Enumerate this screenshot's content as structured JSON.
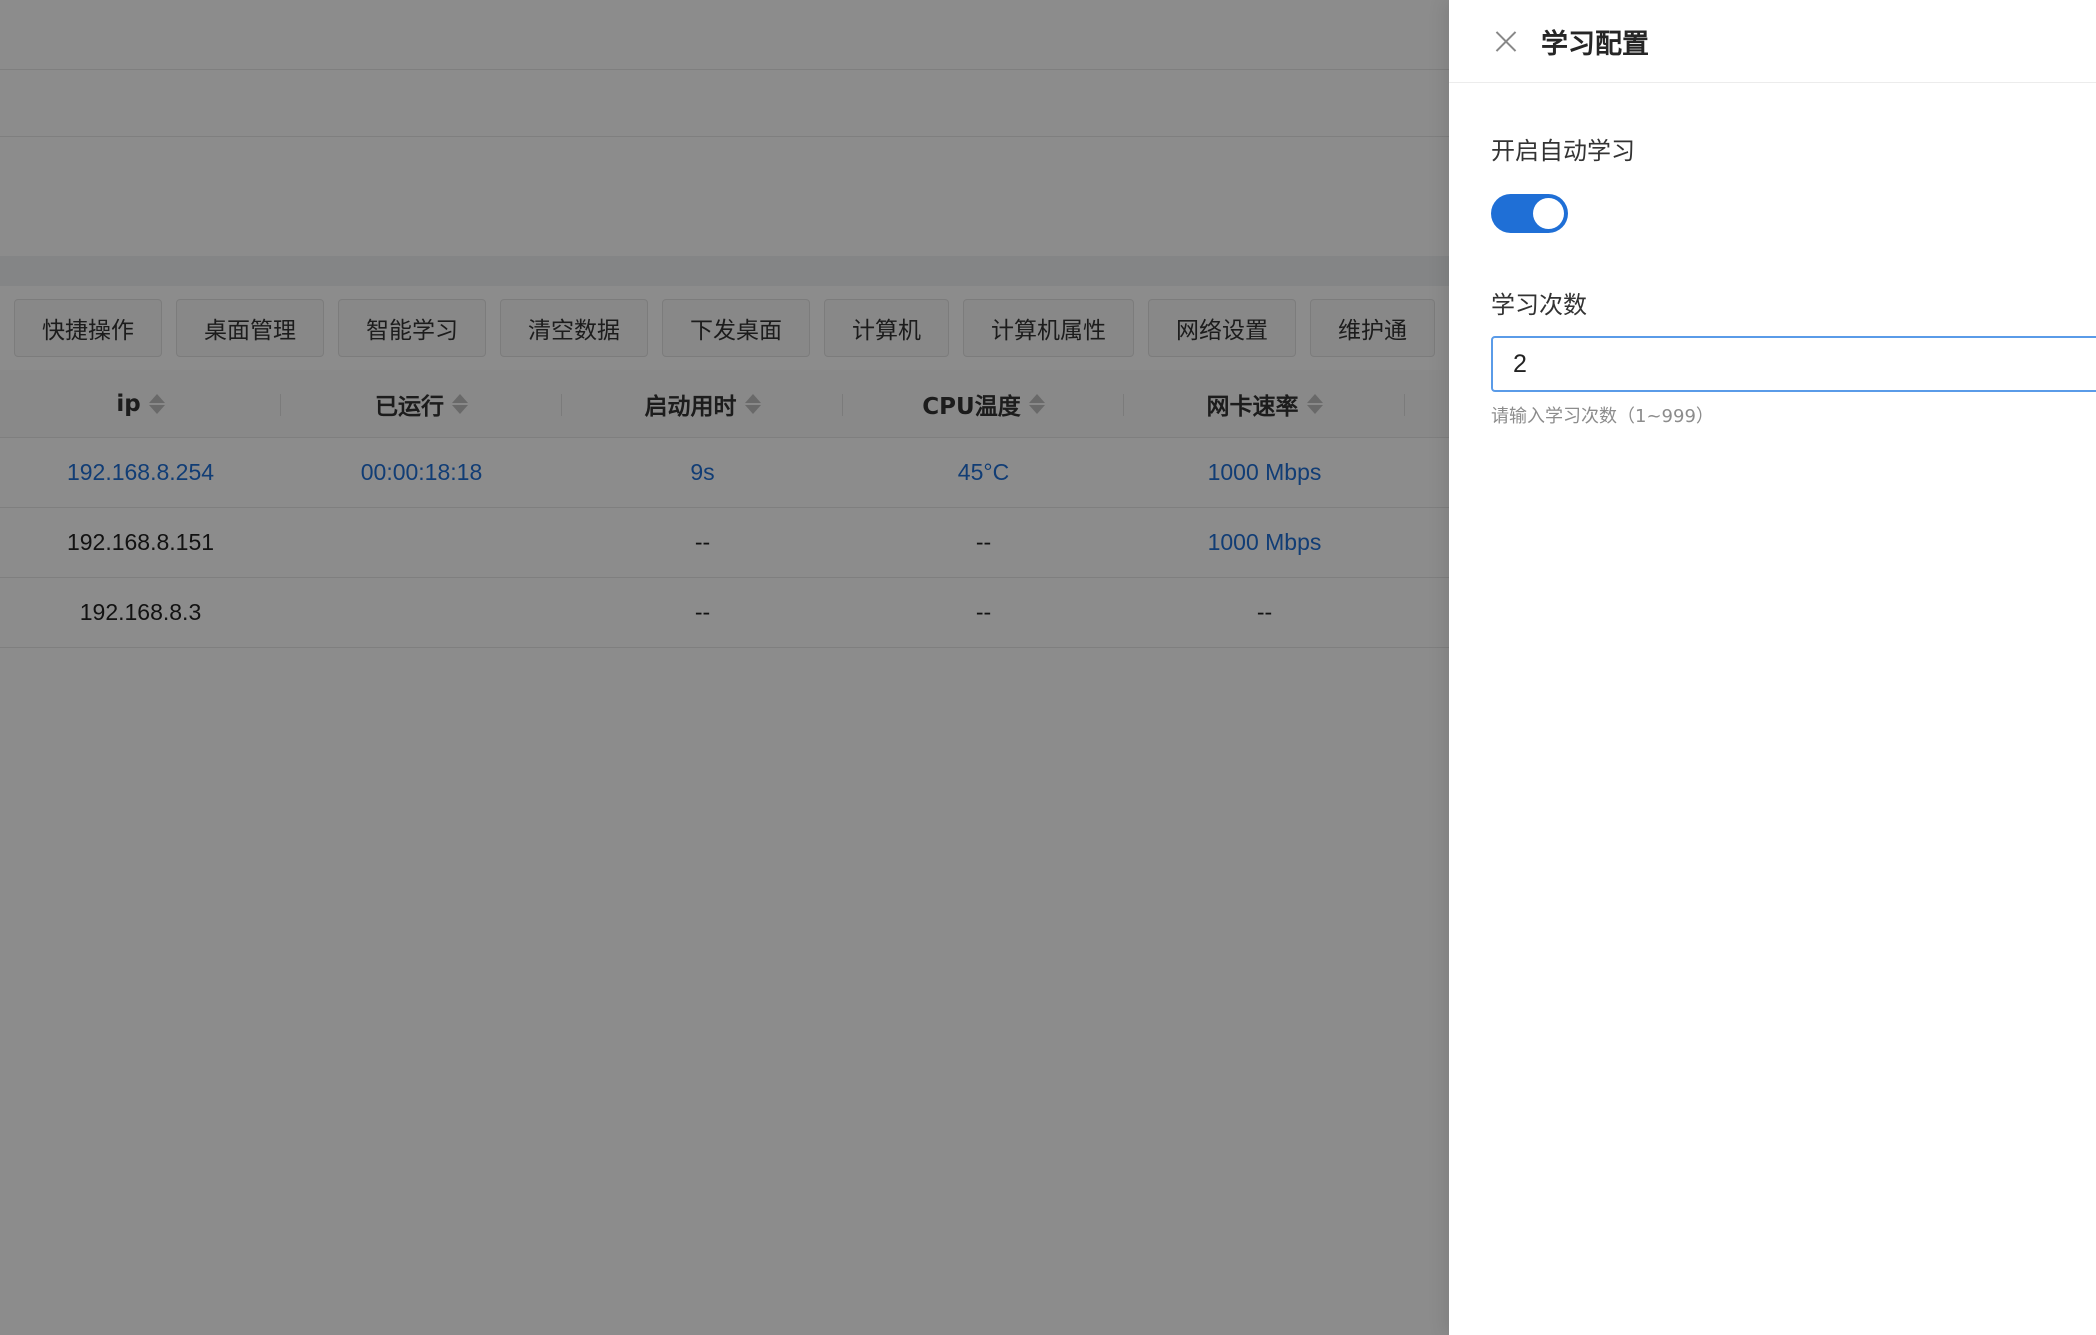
{
  "toolbar": {
    "buttons": [
      "快捷操作",
      "桌面管理",
      "智能学习",
      "清空数据",
      "下发桌面",
      "计算机",
      "计算机属性",
      "网络设置",
      "维护通"
    ]
  },
  "table": {
    "columns": [
      "ip",
      "已运行",
      "启动用时",
      "CPU温度",
      "网卡速率"
    ],
    "rows": [
      {
        "ip": "192.168.8.254",
        "uptime": "00:00:18:18",
        "boot_time": "9s",
        "cpu_temp": "45°C",
        "nic_speed": "1000 Mbps"
      },
      {
        "ip": "192.168.8.151",
        "uptime": "",
        "boot_time": "--",
        "cpu_temp": "--",
        "nic_speed": "1000 Mbps"
      },
      {
        "ip": "192.168.8.3",
        "uptime": "",
        "boot_time": "--",
        "cpu_temp": "--",
        "nic_speed": "--"
      }
    ]
  },
  "drawer": {
    "title": "学习配置",
    "auto_learn_label": "开启自动学习",
    "auto_learn_enabled": true,
    "count_label": "学习次数",
    "count_value": "2",
    "count_hint": "请输入学习次数（1~999）"
  },
  "colors": {
    "accent": "#1f6fd6",
    "mask": "rgba(0,0,0,0.45)"
  }
}
